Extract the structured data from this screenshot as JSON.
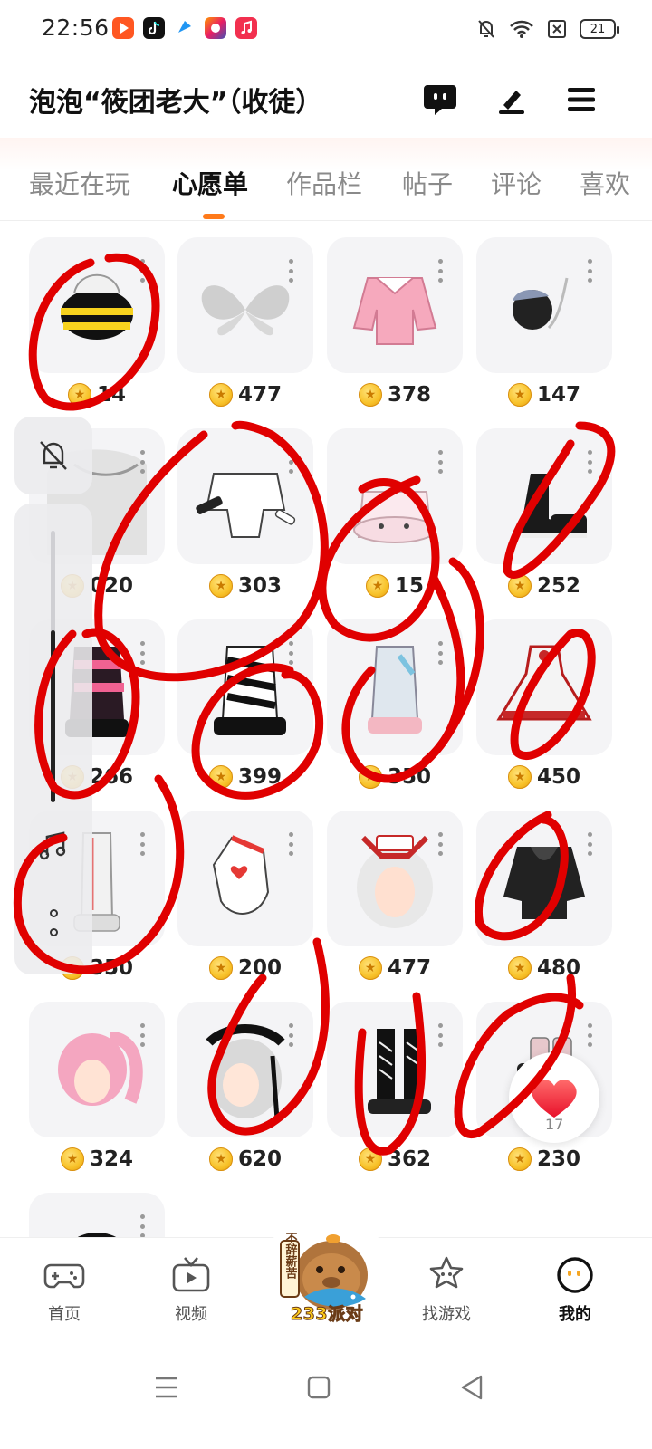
{
  "status_bar": {
    "time": "22:56",
    "battery": "21",
    "icons": [
      "video-app-icon",
      "tiktok-icon",
      "app-icon",
      "app-icon",
      "music-icon",
      "mute-bell-icon",
      "wifi-icon",
      "sim-off-icon",
      "battery-icon"
    ]
  },
  "header": {
    "title": "泡泡“筱团老大”（收徒）",
    "icons": [
      "chat-icon",
      "edit-icon",
      "menu-icon"
    ]
  },
  "tabs": [
    {
      "label": "最近在玩",
      "active": false
    },
    {
      "label": "心愿单",
      "active": true
    },
    {
      "label": "作品栏",
      "active": false
    },
    {
      "label": "帖子",
      "active": false
    },
    {
      "label": "评论",
      "active": false
    },
    {
      "label": "喜欢",
      "active": false
    }
  ],
  "accent_color": "#ff7a1a",
  "annotation_color": "#e00000",
  "items": [
    {
      "name": "bee helmet",
      "price": "14"
    },
    {
      "name": "white wings",
      "price": "477"
    },
    {
      "name": "pink sailor top",
      "price": "378"
    },
    {
      "name": "dark flower accessory",
      "price": "147"
    },
    {
      "name": "white hair",
      "price": "020"
    },
    {
      "name": "white crop jacket",
      "price": "303"
    },
    {
      "name": "bunny slippers",
      "price": "15"
    },
    {
      "name": "black platform shoes",
      "price": "252"
    },
    {
      "name": "punk boots",
      "price": "266"
    },
    {
      "name": "striped boots",
      "price": "399"
    },
    {
      "name": "leg warmers",
      "price": "350"
    },
    {
      "name": "red frill dress",
      "price": "450"
    },
    {
      "name": "white tall boots",
      "price": "350"
    },
    {
      "name": "heart glove",
      "price": "200"
    },
    {
      "name": "nurse horn hair",
      "price": "477"
    },
    {
      "name": "black hoodie",
      "price": "480"
    },
    {
      "name": "pink ponytail hair",
      "price": "324"
    },
    {
      "name": "gothic lolita hair",
      "price": "620"
    },
    {
      "name": "lace-up boots",
      "price": "362"
    },
    {
      "name": "pink shoes",
      "price": "230"
    },
    {
      "name": "black hair",
      "price": ""
    }
  ],
  "like_count": "17",
  "bottom_nav": [
    {
      "label": "首页",
      "icon": "gamepad-icon"
    },
    {
      "label": "视频",
      "icon": "tv-icon"
    },
    {
      "label": "233派对",
      "icon": "party-capybara-icon"
    },
    {
      "label": "找游戏",
      "icon": "star-search-icon"
    },
    {
      "label": "我的",
      "icon": "profile-face-icon",
      "active": true
    }
  ],
  "party_badge_text": "233派对",
  "party_sign_text": "不辞薪苦"
}
